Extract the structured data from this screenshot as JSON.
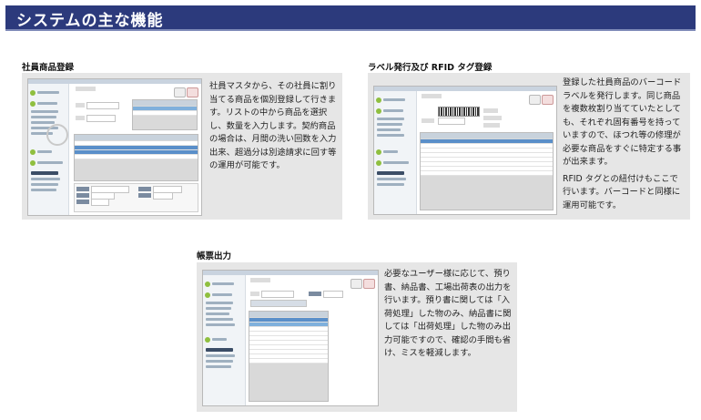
{
  "header": {
    "title": "システムの主な機能"
  },
  "sections": [
    {
      "title": "社員商品登録",
      "description": [
        "社員マスタから、その社員に割り当てる商品を個別登録して行きます。リストの中から商品を選択し、数量を入力します。契約商品の場合は、月間の洗い回数を入力出来、超過分は別途請求に回す等の運用が可能です。"
      ]
    },
    {
      "title": "ラベル発行及び RFID タグ登録",
      "description": [
        "登録した社員商品のバーコードラベルを発行します。同じ商品を複数枚割り当てていたとしても、それぞれ固有番号を持っていますので、ほつれ等の修理が必要な商品をすぐに特定する事が出来ます。",
        "RFID タグとの紐付けもここで行います。バーコードと同様に運用可能です。"
      ]
    },
    {
      "title": "帳票出力",
      "description": [
        "必要なユーザー様に応じて、預り書、納品書、工場出荷表の出力を行います。預り書に関しては「入荷処理」した物のみ、納品書に関しては「出荷処理」した物のみ出力可能ですので、確認の手間も省け、ミスを軽減します。"
      ]
    }
  ],
  "colors": {
    "banner": "#2c3a7c",
    "panel": "#e6e6e6",
    "selection": "#5a8fc9",
    "accent_green": "#8fbf3f"
  }
}
